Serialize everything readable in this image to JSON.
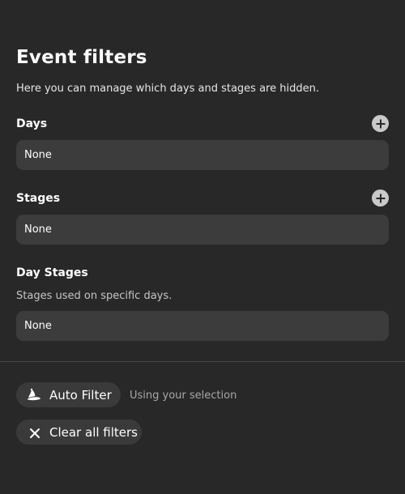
{
  "header": {
    "title": "Event filters",
    "description": "Here you can manage which days and stages are hidden."
  },
  "days": {
    "label": "Days",
    "value": "None",
    "add_icon": "plus-circle-icon"
  },
  "stages": {
    "label": "Stages",
    "value": "None",
    "add_icon": "plus-circle-icon"
  },
  "day_stages": {
    "label": "Day Stages",
    "description": "Stages used on specific days.",
    "value": "None"
  },
  "actions": {
    "auto_filter": {
      "label": "Auto Filter",
      "icon": "wizard-hat-icon",
      "hint": "Using your selection"
    },
    "clear_filters": {
      "label": "Clear all filters",
      "icon": "close-icon"
    }
  },
  "colors": {
    "background": "#282828",
    "field": "#3c3c3c",
    "pill": "#3a3a3a",
    "text": "#ffffff",
    "muted": "#a8a8a8"
  }
}
